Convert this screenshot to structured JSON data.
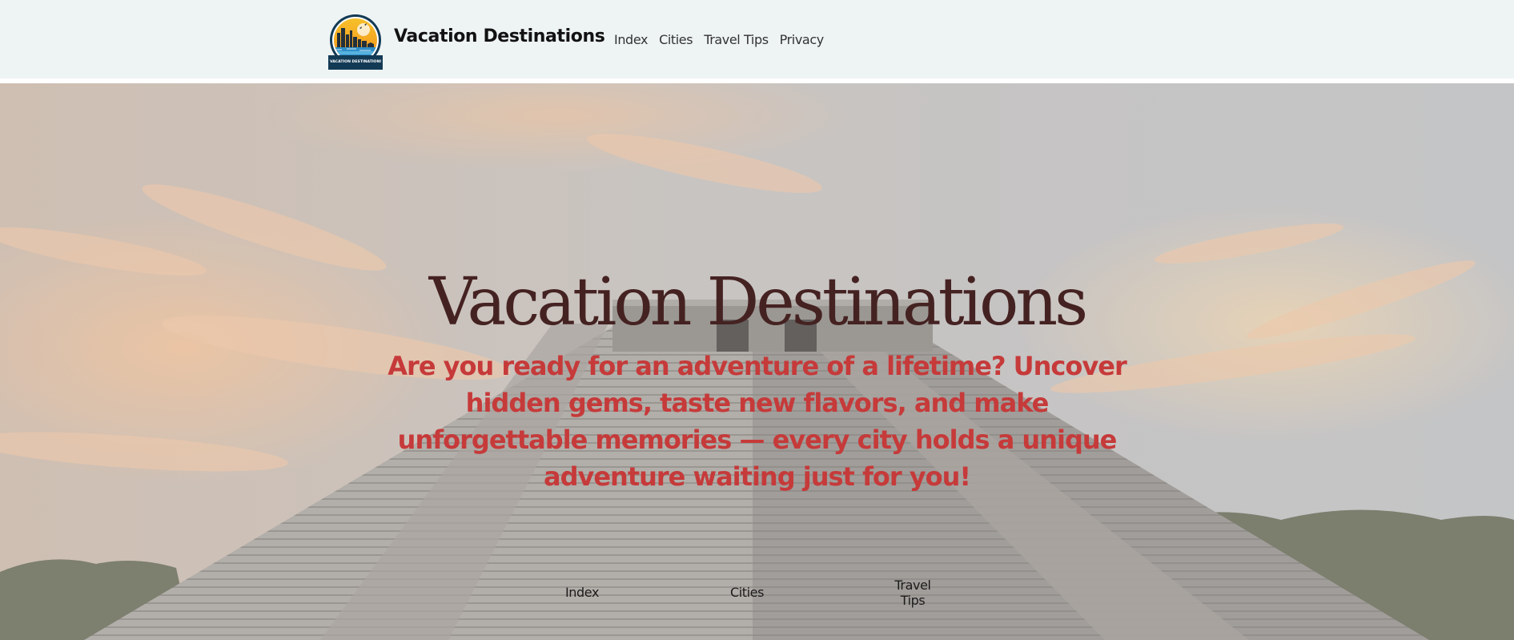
{
  "header": {
    "logo_caption": "VACATION DESTINATIONS",
    "brand": "Vacation Destinations",
    "nav": [
      "Index",
      "Cities",
      "Travel Tips",
      "Privacy"
    ]
  },
  "hero": {
    "title": "Vacation Destinations",
    "subtitle": "Are you ready for an adventure of a lifetime? Uncover hidden gems, taste new flavors, and make unforgettable memories — every city holds a unique adventure waiting just for you!",
    "links": {
      "index": "Index",
      "cities": "Cities",
      "travel_tips_line1": "Travel",
      "travel_tips_line2": "Tips"
    }
  },
  "colors": {
    "header_bg": "#eef3f4",
    "title": "#452222",
    "subtitle": "#c63a3a"
  }
}
